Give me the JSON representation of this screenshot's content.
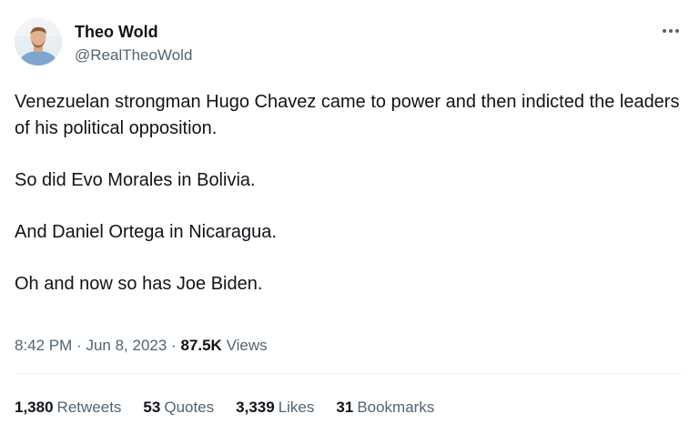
{
  "author": {
    "display_name": "Theo Wold",
    "handle": "@RealTheoWold"
  },
  "tweet": {
    "paragraphs": [
      "Venezuelan strongman Hugo Chavez came to power and then indicted the leaders of his political opposition.",
      "So did Evo Morales in Bolivia.",
      "And Daniel Ortega in Nicaragua.",
      "Oh and now so has Joe Biden."
    ],
    "time": "8:42 PM",
    "date": "Jun 8, 2023",
    "separator": "·",
    "views_count": "87.5K",
    "views_label": "Views"
  },
  "stats": {
    "retweets": {
      "count": "1,380",
      "label": "Retweets"
    },
    "quotes": {
      "count": "53",
      "label": "Quotes"
    },
    "likes": {
      "count": "3,339",
      "label": "Likes"
    },
    "bookmarks": {
      "count": "31",
      "label": "Bookmarks"
    }
  },
  "icons": {
    "avatar": "avatar-photo",
    "more": "more-options-icon"
  },
  "colors": {
    "text_primary": "#0f1419",
    "text_secondary": "#536471",
    "divider": "#eff3f4"
  }
}
